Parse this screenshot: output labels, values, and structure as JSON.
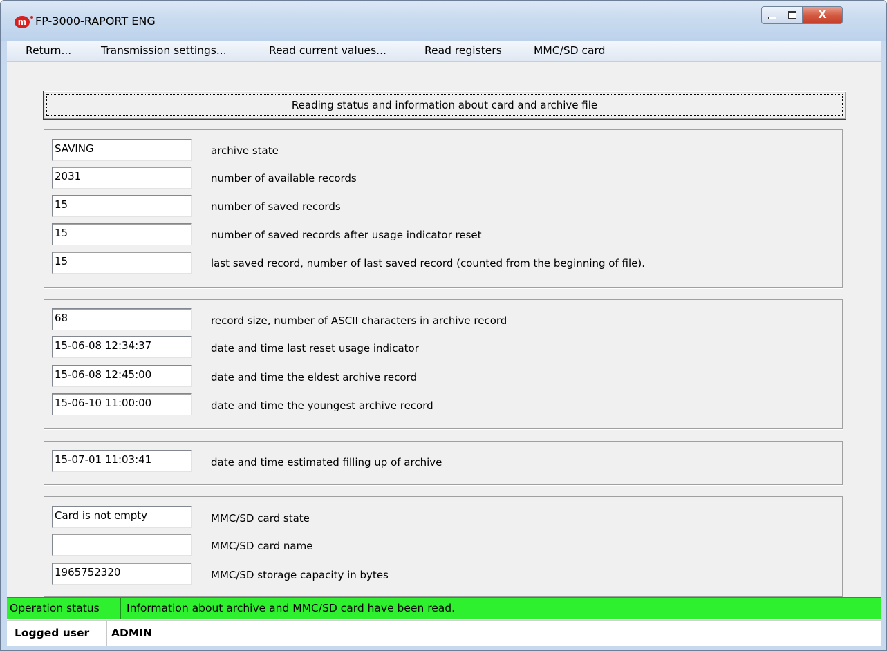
{
  "window": {
    "title": "FP-3000-RAPORT ENG",
    "icon_letter": "m",
    "close_glyph": "X"
  },
  "menu": {
    "items": [
      {
        "pre": "",
        "u": "R",
        "post": "eturn..."
      },
      {
        "pre": "",
        "u": "T",
        "post": "ransmission settings..."
      },
      {
        "pre": "R",
        "u": "e",
        "post": "ad current values..."
      },
      {
        "pre": "Re",
        "u": "a",
        "post": "d registers"
      },
      {
        "pre": "",
        "u": "M",
        "post": "MC/SD card"
      }
    ]
  },
  "header_button": {
    "label": "Reading status and information about card and archive file"
  },
  "groups": {
    "archive": [
      {
        "value": "SAVING",
        "label": "archive state"
      },
      {
        "value": "2031",
        "label": "number of available records"
      },
      {
        "value": "15",
        "label": "number of saved records"
      },
      {
        "value": "15",
        "label": "number of saved records after usage indicator reset"
      },
      {
        "value": "15",
        "label": "last saved record, number of last saved record (counted from the beginning of file)."
      }
    ],
    "records": [
      {
        "value": "68",
        "label": "record size, number of ASCII characters in archive record"
      },
      {
        "value": "15-06-08 12:34:37",
        "label": "date and time last reset usage indicator"
      },
      {
        "value": "15-06-08 12:45:00",
        "label": "date and time the eldest archive record"
      },
      {
        "value": "15-06-10 11:00:00",
        "label": "date and time the youngest archive record"
      }
    ],
    "estimate": [
      {
        "value": "15-07-01 11:03:41",
        "label": "date and time estimated filling up of archive"
      }
    ],
    "card": [
      {
        "value": "Card is not empty",
        "label": "MMC/SD card state"
      },
      {
        "value": "",
        "label": "MMC/SD card name"
      },
      {
        "value": "1965752320",
        "label": "MMC/SD storage capacity in bytes"
      }
    ]
  },
  "status": {
    "label": "Operation status",
    "text": "Information about archive and MMC/SD card have been read.",
    "color": "#2ef02e"
  },
  "user": {
    "label": "Logged user",
    "value": "ADMIN"
  }
}
